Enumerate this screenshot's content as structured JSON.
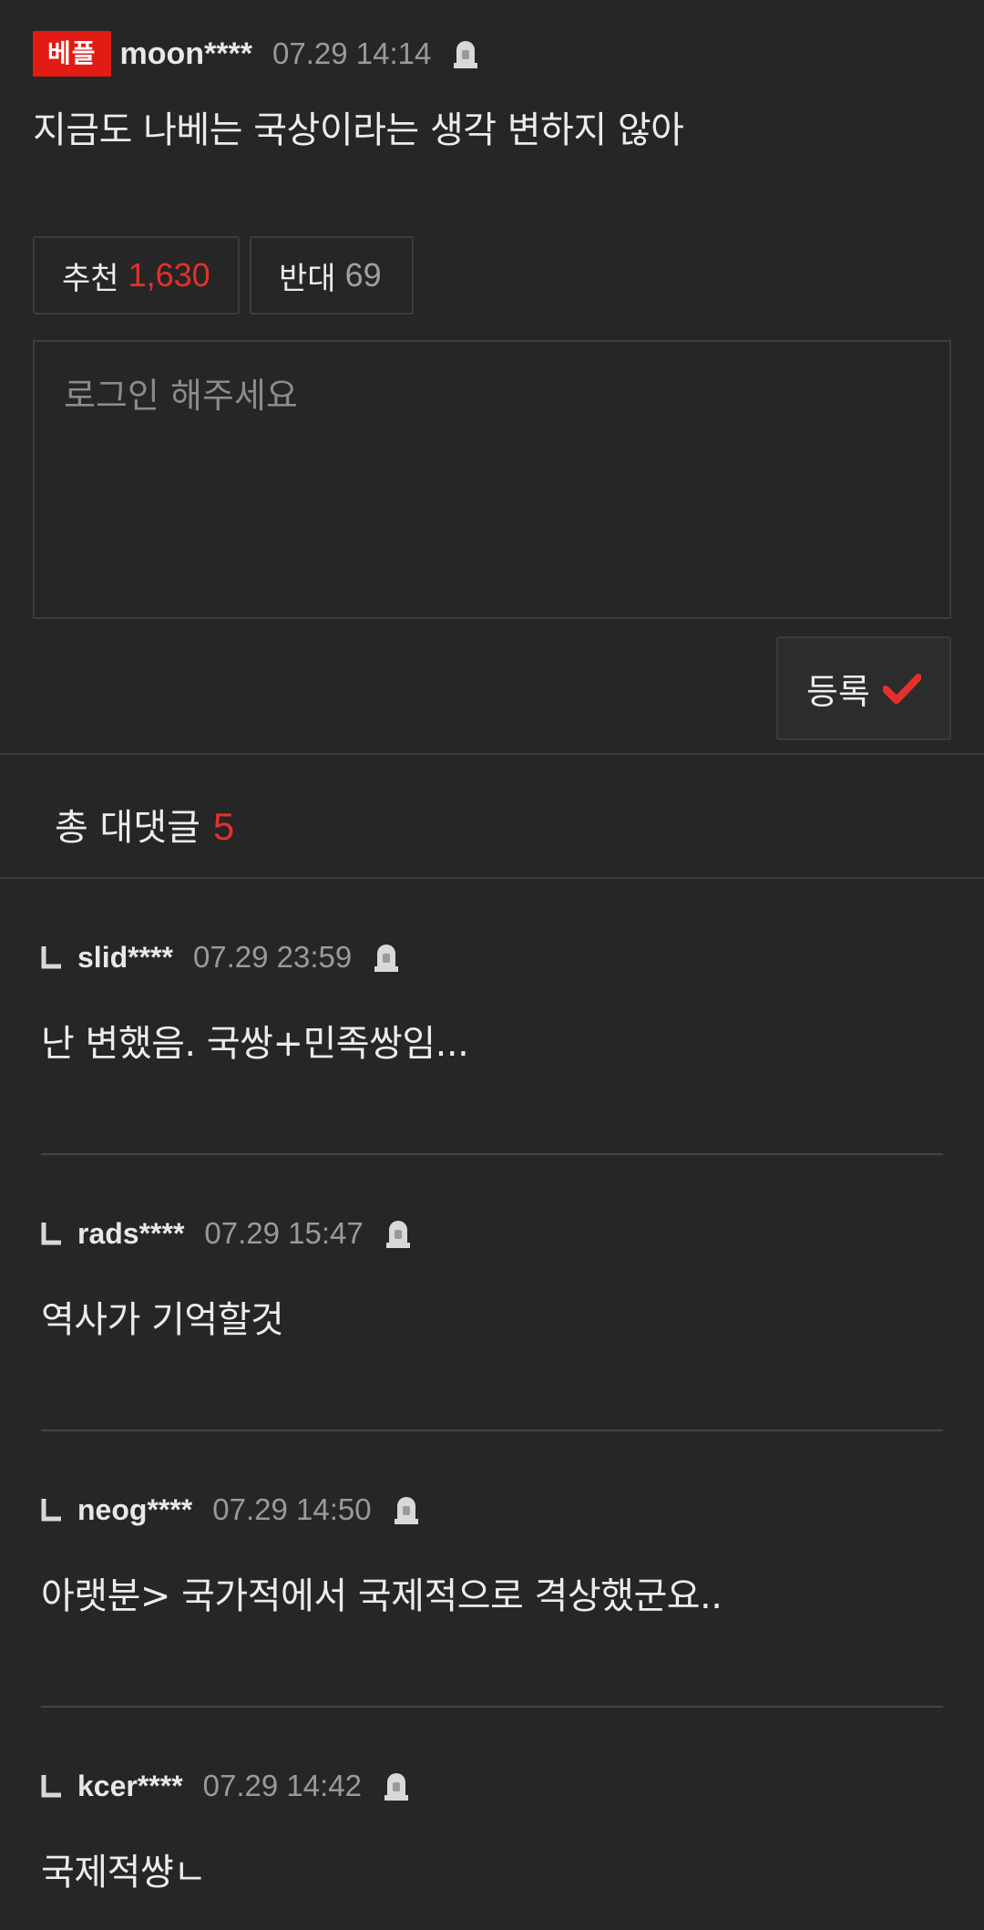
{
  "main_comment": {
    "badge": "베플",
    "username": "moon****",
    "timestamp": "07.29 14:14",
    "text": "지금도 나베는 국상이라는 생각 변하지 않아",
    "upvote_label": "추천",
    "upvote_count": "1,630",
    "downvote_label": "반대",
    "downvote_count": "69"
  },
  "reply_input": {
    "placeholder": "로그인 해주세요",
    "submit_label": "등록"
  },
  "replies_header": {
    "label": "총 대댓글",
    "count": "5"
  },
  "replies": [
    {
      "username": "slid****",
      "timestamp": "07.29 23:59",
      "text": "난 변했음. 국쌍+민족쌍임..."
    },
    {
      "username": "rads****",
      "timestamp": "07.29 15:47",
      "text": "역사가 기억할것"
    },
    {
      "username": "neog****",
      "timestamp": "07.29 14:50",
      "text": "아랫분> 국가적에서 국제적으로 격상했군요.."
    },
    {
      "username": "kcer****",
      "timestamp": "07.29 14:42",
      "text": "국제적썅ㄴ"
    }
  ],
  "colors": {
    "background": "#262626",
    "accent_red": "#e21b14",
    "count_red": "#e5302a",
    "muted_text": "#9a9a9a"
  },
  "icons": [
    "siren-icon",
    "check-icon",
    "reply-arrow-icon"
  ]
}
